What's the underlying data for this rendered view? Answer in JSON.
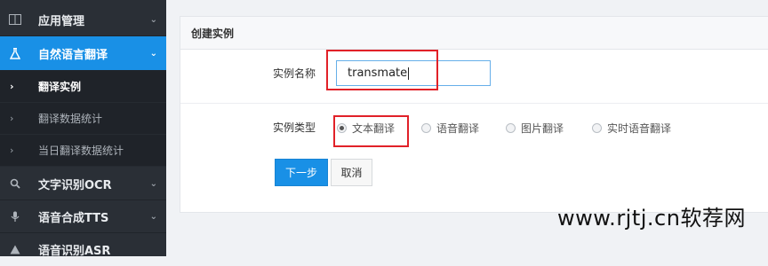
{
  "sidebar": {
    "items": [
      {
        "label": "应用管理",
        "icon": "panel-icon"
      },
      {
        "label": "自然语言翻译",
        "icon": "flask-icon",
        "active": true
      },
      {
        "label": "文字识别OCR",
        "icon": "search-icon"
      },
      {
        "label": "语音合成TTS",
        "icon": "microphone-icon"
      },
      {
        "label": "语音识别ASR",
        "icon": "warning-icon"
      }
    ],
    "sub_items": [
      {
        "label": "翻译实例"
      },
      {
        "label": "翻译数据统计"
      },
      {
        "label": "当日翻译数据统计"
      }
    ]
  },
  "panel": {
    "title": "创建实例",
    "name_label": "实例名称",
    "name_value": "transmate",
    "type_label": "实例类型",
    "types": [
      {
        "label": "文本翻译",
        "checked": true
      },
      {
        "label": "语音翻译",
        "checked": false
      },
      {
        "label": "图片翻译",
        "checked": false
      },
      {
        "label": "实时语音翻译",
        "checked": false
      }
    ],
    "next_button": "下一步",
    "cancel_button": "取消"
  },
  "watermark": "www.rjtj.cn软荐网",
  "colors": {
    "accent": "#1990e6",
    "sidebar": "#2a2f36",
    "highlight": "#e12128"
  }
}
